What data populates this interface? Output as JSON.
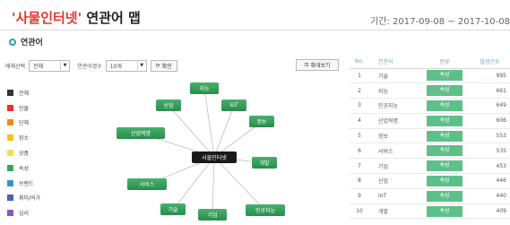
{
  "header": {
    "title_quoted": "'사물인터넷'",
    "title_rest": " 연관어 맵",
    "period": "기간: 2017-09-08 ~ 2017-10-08"
  },
  "section": {
    "title": "연관어"
  },
  "controls": {
    "media_label": "매체선택",
    "media_value": "전체",
    "count_label": "연관어갯수",
    "count_value": "10개",
    "confirm_label": "확인",
    "zoom_label": "확대보기"
  },
  "legend": [
    {
      "label": "전체",
      "color": "#333333"
    },
    {
      "label": "인물",
      "color": "#e8312a"
    },
    {
      "label": "단체",
      "color": "#f08a1e"
    },
    {
      "label": "장소",
      "color": "#f5c21b"
    },
    {
      "label": "상품",
      "color": "#f5dd55"
    },
    {
      "label": "속성",
      "color": "#3aa860"
    },
    {
      "label": "브랜드",
      "color": "#3b8fd0"
    },
    {
      "label": "취미/여가",
      "color": "#4b5fbf"
    },
    {
      "label": "심리",
      "color": "#8a55b8"
    }
  ],
  "graph": {
    "center": "사물인터넷",
    "nodes": [
      "지능",
      "산업",
      "IoT",
      "정보",
      "산업혁명",
      "개발",
      "서비스",
      "기술",
      "기업",
      "인공지능"
    ]
  },
  "table": {
    "headers": {
      "no": "No.",
      "word": "연관어",
      "attr": "분류",
      "freq": "발생건수"
    },
    "rows": [
      {
        "no": "1",
        "word": "기술",
        "attr": "속성",
        "freq": "995"
      },
      {
        "no": "2",
        "word": "지능",
        "attr": "속성",
        "freq": "661"
      },
      {
        "no": "3",
        "word": "인공지능",
        "attr": "속성",
        "freq": "649"
      },
      {
        "no": "4",
        "word": "산업혁명",
        "attr": "속성",
        "freq": "606"
      },
      {
        "no": "5",
        "word": "정보",
        "attr": "속성",
        "freq": "553"
      },
      {
        "no": "6",
        "word": "서비스",
        "attr": "속성",
        "freq": "535"
      },
      {
        "no": "7",
        "word": "기업",
        "attr": "속성",
        "freq": "453"
      },
      {
        "no": "8",
        "word": "산업",
        "attr": "속성",
        "freq": "446"
      },
      {
        "no": "9",
        "word": "IoT",
        "attr": "속성",
        "freq": "440"
      },
      {
        "no": "10",
        "word": "개발",
        "attr": "속성",
        "freq": "409"
      }
    ]
  }
}
